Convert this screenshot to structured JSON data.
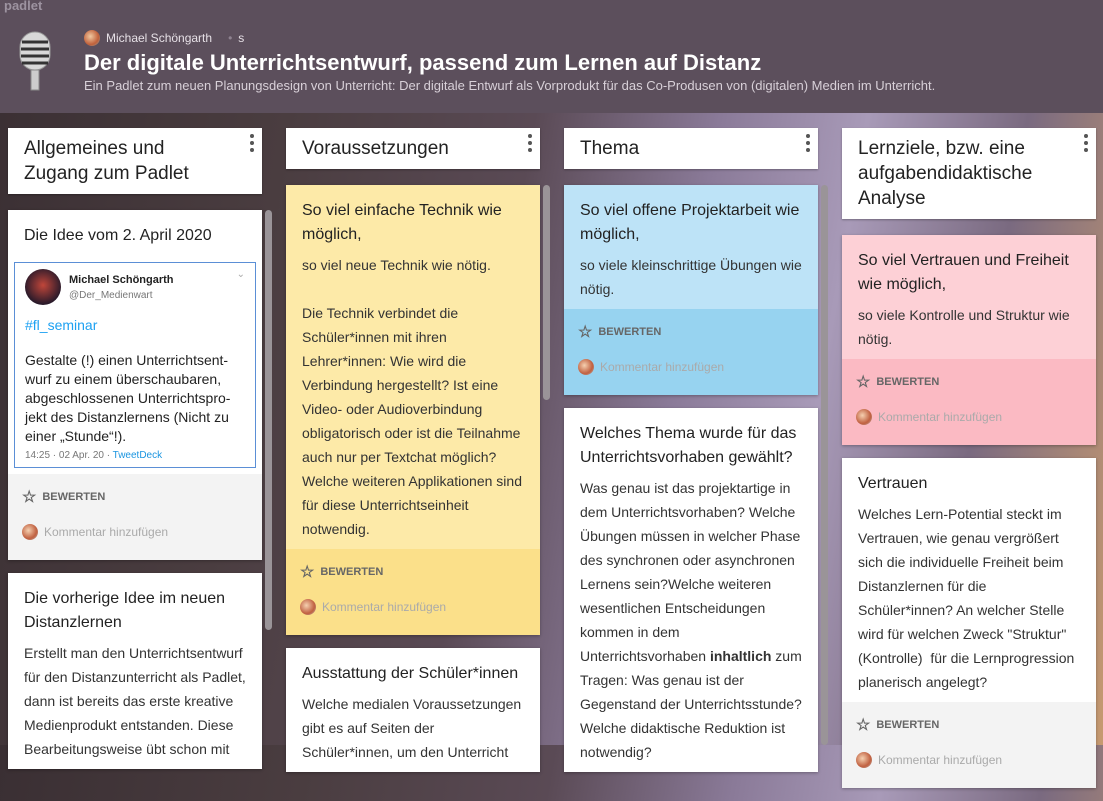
{
  "app": {
    "brand": "padlet",
    "author": "Michael Schöngarth",
    "visibility": "s",
    "title": "Der digitale Unterrichtsentwurf, passend zum Lernen auf Distanz",
    "subtitle": "Ein Padlet zum neuen Planungsdesign von Unterricht: Der digitale Entwurf als Vorprodukt für das Co-Produsen von (digitalen) Medien im Unterricht."
  },
  "labels": {
    "rate": "BEWERTEN",
    "comment": "Kommentar hinzufügen"
  },
  "colors": {
    "header": "#5c4f5c",
    "yellow": "#fdeaa8",
    "yellow_foot": "#fbe08a",
    "blue": "#bde3f7",
    "blue_foot": "#97d3f0",
    "pink": "#fdd0d6",
    "pink_foot": "#fbbac3",
    "white_foot": "#f3f3f3"
  },
  "columns": [
    {
      "title": "Allgemeines und Zugang zum Padlet",
      "cards": [
        {
          "title": "Die Idee vom 2. April 2020",
          "color": "white",
          "tweet": {
            "name": "Michael Schöngarth",
            "handle": "@Der_Medienwart",
            "hashtag": "#fl_seminar",
            "text": "Gestalte (!) einen Unterrichtsent-wurf zu einem überschaubaren, abgeschlossenen Unterrichtspro-jekt des Distanzlernens (Nicht zu einer „Stunde“!).",
            "meta": "14:25 · 02 Apr. 20 · ",
            "source": "TweetDeck"
          },
          "footer": true
        },
        {
          "title": "Die vorherige Idee im neuen Distanzlernen",
          "color": "white",
          "text": [
            {
              "t": "Erstellt man den Unterrichtsentwurf für den Distanzunterricht als Padlet, dann ist bereits das erste kreative Medienprodukt entstanden. Diese Bearbeitungsweise übt schon mit"
            }
          ],
          "footer": false
        }
      ]
    },
    {
      "title": "Voraussetzungen",
      "cards": [
        {
          "title": "So viel einfache Technik wie möglich,",
          "color": "yellow",
          "text": [
            {
              "t": "so viel neue Technik wie nötig.\n\nDie Technik verbindet die Schüler*innen mit ihren Lehrer*innen: Wie wird die Verbindung hergestellt? Ist eine Video- oder Audioverbindung obligatorisch oder ist die Teilnahme auch nur per Textchat möglich? Welche weiteren Applikationen sind für diese Unterrichtseinheit notwendig."
            }
          ],
          "footer": true
        },
        {
          "title": "Ausstattung der Schüler*innen",
          "color": "white",
          "text": [
            {
              "t": "Welche medialen Voraussetzungen gibt es auf Seiten der Schüler*innen, um den Unterricht"
            }
          ],
          "footer": false
        }
      ]
    },
    {
      "title": "Thema",
      "cards": [
        {
          "title": "So viel offene Projektarbeit wie möglich,",
          "color": "blue",
          "text": [
            {
              "t": "so viele kleinschrittige Übungen wie nötig."
            }
          ],
          "footer": true
        },
        {
          "title": "Welches Thema wurde für das Unterrichtsvorhaben gewählt?",
          "color": "white",
          "text": [
            {
              "t": "Was genau ist das projektartige in dem Unterrichtsvorhaben? Welche Übungen müssen in welcher Phase des synchronen oder asynchronen Lernens sein?Welche weiteren wesentlichen Entscheidungen kommen in dem Unterrichtsvorhaben "
            },
            {
              "t": "inhaltlich",
              "b": true
            },
            {
              "t": " zum Tragen: Was genau ist der Gegenstand der Unterrichtsstunde? Welche didaktische Reduktion ist notwendig?"
            }
          ],
          "footer": false
        }
      ]
    },
    {
      "title": "Lernziele, bzw. eine aufgabendidaktische Analyse",
      "cards": [
        {
          "title": "So viel Vertrauen und Freiheit wie möglich,",
          "color": "pink",
          "text": [
            {
              "t": "so viele Kontrolle und Struktur wie nötig."
            }
          ],
          "footer": true
        },
        {
          "title": "Vertrauen",
          "color": "white",
          "text": [
            {
              "t": "Welches Lern-Potential steckt im Vertrauen, wie genau vergrößert sich die individuelle Freiheit beim Distanzlernen für die Schüler*innen? An welcher Stelle wird für welchen Zweck \"Struktur\" (Kontrolle)  für die Lernprogression planerisch angelegt?"
            }
          ],
          "footer": true
        }
      ]
    }
  ]
}
